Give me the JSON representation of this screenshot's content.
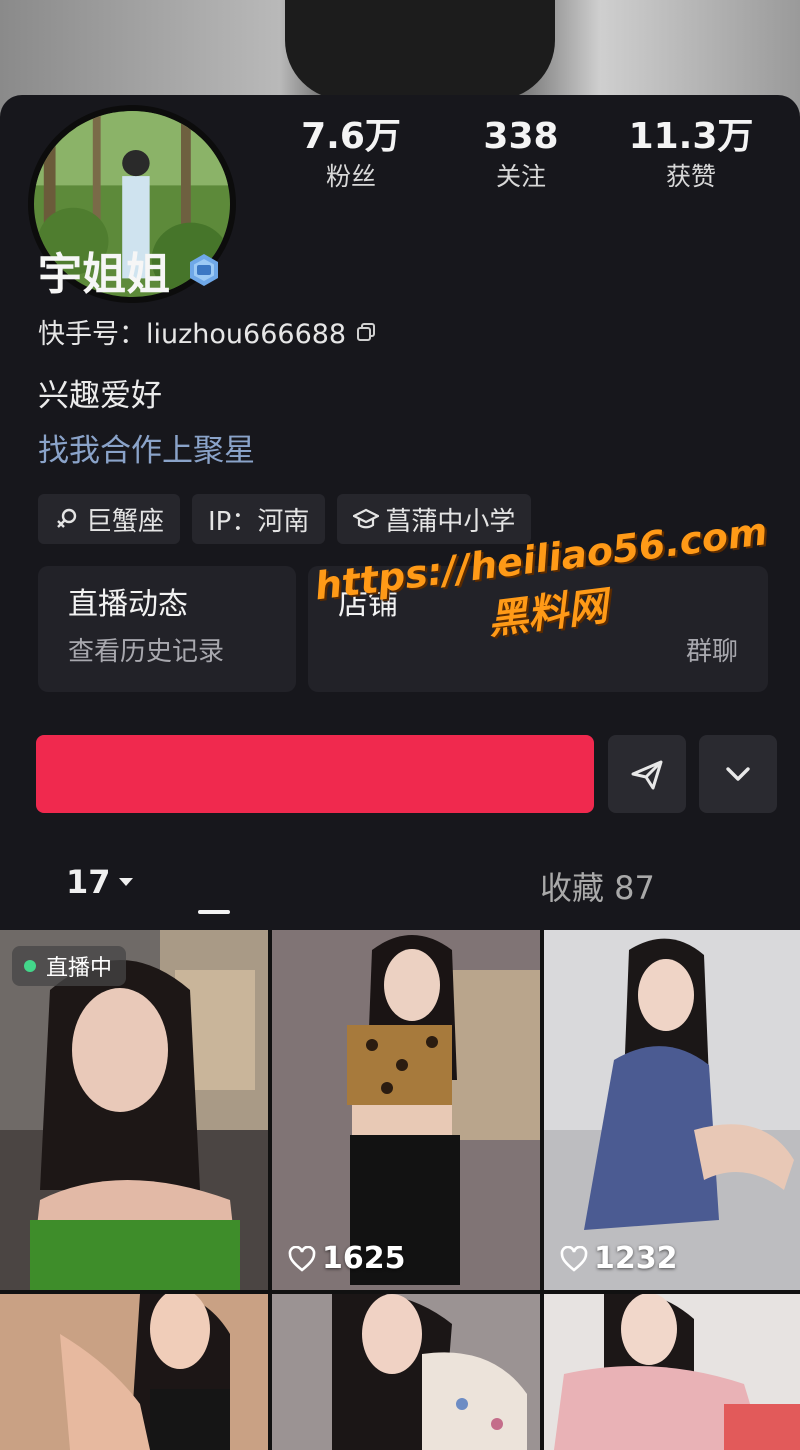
{
  "profile": {
    "name": "宇姐姐",
    "kuaishou_id": "快手号：liuzhou666688",
    "bio": "兴趣爱好",
    "link_text": "找我合作上聚星"
  },
  "stats": [
    {
      "value": "7.6万",
      "label": "粉丝"
    },
    {
      "value": "338",
      "label": "关注"
    },
    {
      "value": "11.3万",
      "label": "获赞"
    }
  ],
  "tags": {
    "zodiac": "巨蟹座",
    "ip": "IP：河南",
    "school": "菖蒲中小学"
  },
  "cards": {
    "live": {
      "title": "直播动态",
      "subtitle": "查看历史记录"
    },
    "shop": {
      "title": "店铺",
      "subtitle": "群聊"
    }
  },
  "watermark": {
    "url": "https://heiliao56.com",
    "name": "黑料网"
  },
  "tabs": {
    "works_count": "17",
    "favorites": "收藏 87"
  },
  "grid": {
    "live_badge": "直播中",
    "likes": [
      "1625",
      "1232"
    ]
  },
  "colors": {
    "follow_button": "#f0294e",
    "link": "#8aa3c9",
    "watermark": "#ff9a17",
    "live_dot": "#43d68a"
  },
  "icons": {
    "verified": "verified-badge-icon",
    "copy": "copy-icon",
    "zodiac": "female-symbol-icon",
    "school": "graduation-cap-icon",
    "share": "send-icon",
    "more": "chevron-down-icon",
    "likes": "heart-icon"
  }
}
